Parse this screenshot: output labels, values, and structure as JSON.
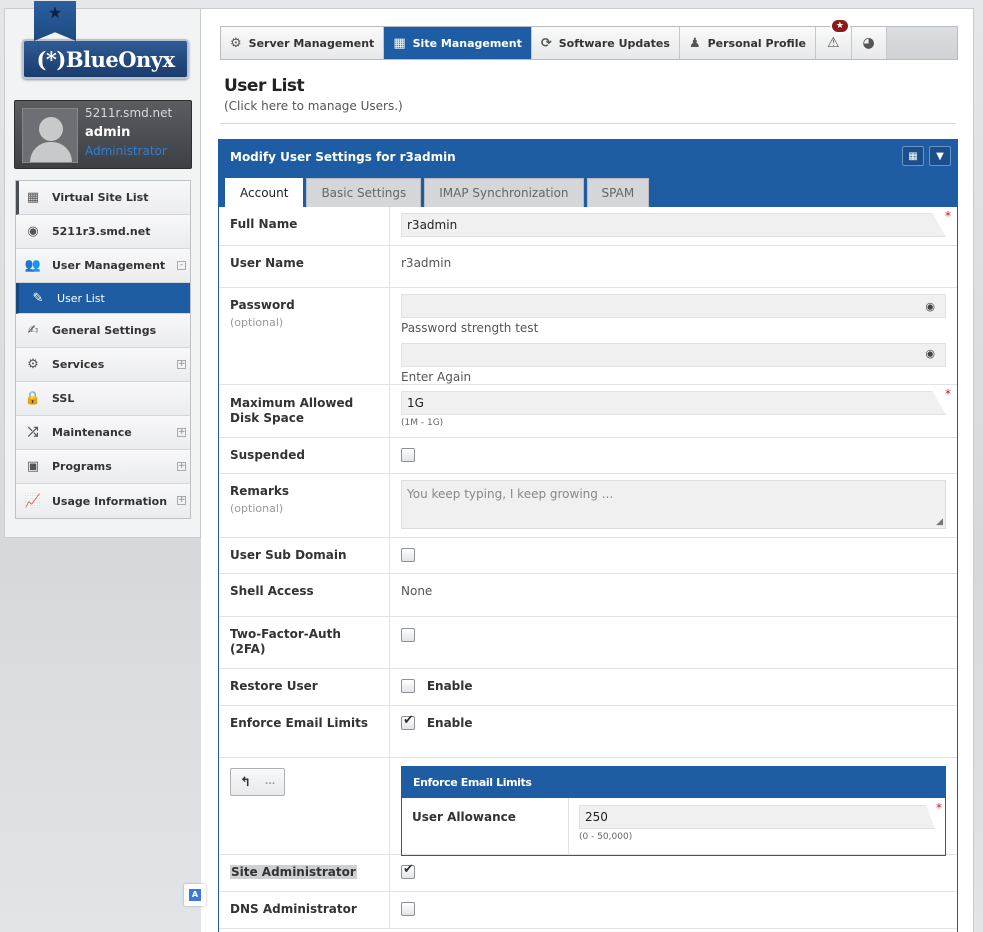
{
  "brand": {
    "logo_text": "(*)BlueOnyx"
  },
  "user": {
    "host": "5211r.smd.net",
    "name": "admin",
    "role": "Administrator"
  },
  "sidebar": {
    "items": [
      {
        "label": "Virtual Site List",
        "icon": "layout-icon"
      },
      {
        "label": "5211r3.smd.net",
        "icon": "globe-icon"
      },
      {
        "label": "User Management",
        "icon": "users-icon",
        "expander": "-"
      },
      {
        "label": "User List",
        "icon": "pencil-icon"
      },
      {
        "label": "General Settings",
        "icon": "edit-icon"
      },
      {
        "label": "Services",
        "icon": "gear-icon",
        "expander": "+"
      },
      {
        "label": "SSL",
        "icon": "lock-icon"
      },
      {
        "label": "Maintenance",
        "icon": "shuffle-icon",
        "expander": "+"
      },
      {
        "label": "Programs",
        "icon": "chip-icon",
        "expander": "+"
      },
      {
        "label": "Usage Information",
        "icon": "chart-icon",
        "expander": "+"
      }
    ]
  },
  "topnav": {
    "items": [
      {
        "label": "Server Management",
        "icon": "gear-icon"
      },
      {
        "label": "Site Management",
        "icon": "layout-icon"
      },
      {
        "label": "Software Updates",
        "icon": "refresh-icon"
      },
      {
        "label": "Personal Profile",
        "icon": "user-icon"
      }
    ],
    "alert_badge": "★"
  },
  "page": {
    "title": "User List",
    "subtitle": "(Click here to manage Users.)"
  },
  "panel": {
    "title": "Modify User Settings for r3admin",
    "tabs": [
      "Account",
      "Basic Settings",
      "IMAP Synchronization",
      "SPAM"
    ]
  },
  "form": {
    "full_name": {
      "label": "Full Name",
      "value": "r3admin"
    },
    "user_name": {
      "label": "User Name",
      "value": "r3admin"
    },
    "password": {
      "label": "Password",
      "optional": "(optional)",
      "strength_text": "Password strength test",
      "again_text": "Enter Again"
    },
    "disk_space": {
      "label": "Maximum Allowed Disk Space",
      "value": "1G",
      "hint": "(1M - 1G)"
    },
    "suspended": {
      "label": "Suspended"
    },
    "remarks": {
      "label": "Remarks",
      "optional": "(optional)",
      "placeholder": "You keep typing, I keep growing ..."
    },
    "user_sub_domain": {
      "label": "User Sub Domain"
    },
    "shell_access": {
      "label": "Shell Access",
      "value": "None"
    },
    "two_factor": {
      "label": "Two-Factor-Auth (2FA)"
    },
    "restore_user": {
      "label": "Restore User",
      "option": "Enable"
    },
    "enforce_email": {
      "label": "Enforce Email Limits",
      "option": "Enable"
    },
    "email_limits_panel": {
      "title": "Enforce Email Limits",
      "user_allowance": {
        "label": "User Allowance",
        "value": "250",
        "hint": "(0 - 50,000)"
      }
    },
    "collapse_dots": "...",
    "site_admin": {
      "label": "Site Administrator"
    },
    "dns_admin": {
      "label": "DNS Administrator"
    }
  },
  "colors": {
    "accent": "#1e5da4",
    "required": "#c41b1b"
  }
}
